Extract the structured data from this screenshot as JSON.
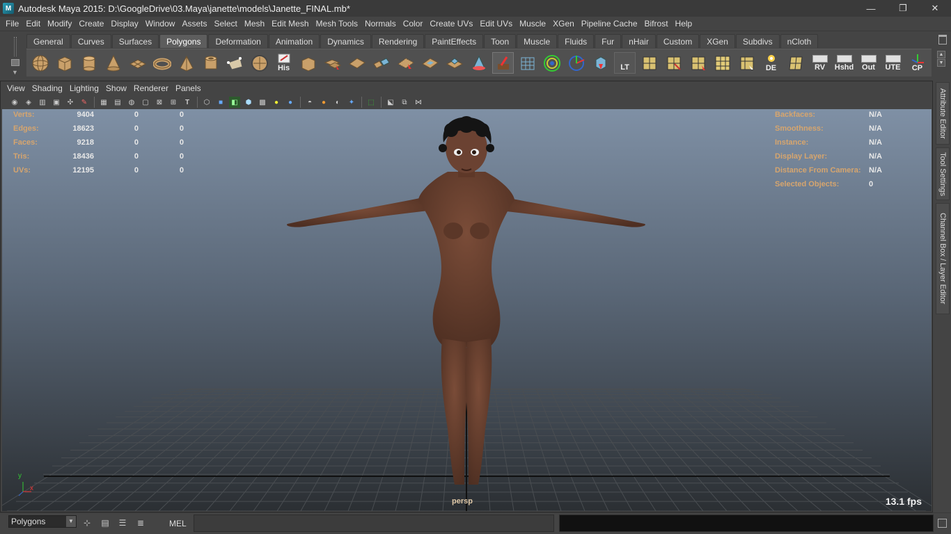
{
  "window": {
    "title": "Autodesk Maya 2015: D:\\GoogleDrive\\03.Maya\\janette\\models\\Janette_FINAL.mb*",
    "minimize_glyph": "—",
    "maximize_glyph": "❐",
    "close_glyph": "✕"
  },
  "menubar": [
    "File",
    "Edit",
    "Modify",
    "Create",
    "Display",
    "Window",
    "Assets",
    "Select",
    "Mesh",
    "Edit Mesh",
    "Mesh Tools",
    "Normals",
    "Color",
    "Create UVs",
    "Edit UVs",
    "Muscle",
    "XGen",
    "Pipeline Cache",
    "Bifrost",
    "Help"
  ],
  "shelf": {
    "tabs": [
      "General",
      "Curves",
      "Surfaces",
      "Polygons",
      "Deformation",
      "Animation",
      "Dynamics",
      "Rendering",
      "PaintEffects",
      "Toon",
      "Muscle",
      "Fluids",
      "Fur",
      "nHair",
      "Custom",
      "XGen",
      "Subdivs",
      "nCloth"
    ],
    "active_tab": "Polygons",
    "text_icons": {
      "his": "His",
      "lt": "LT",
      "de": "DE",
      "rv": "RV",
      "hshd": "Hshd",
      "out": "Out",
      "ute": "UTE",
      "cp": "CP"
    }
  },
  "panel": {
    "menus": [
      "View",
      "Shading",
      "Lighting",
      "Show",
      "Renderer",
      "Panels"
    ]
  },
  "hud": {
    "left": [
      {
        "label": "Verts:",
        "v1": "9404",
        "v2": "0",
        "v3": "0"
      },
      {
        "label": "Edges:",
        "v1": "18623",
        "v2": "0",
        "v3": "0"
      },
      {
        "label": "Faces:",
        "v1": "9218",
        "v2": "0",
        "v3": "0"
      },
      {
        "label": "Tris:",
        "v1": "18436",
        "v2": "0",
        "v3": "0"
      },
      {
        "label": "UVs:",
        "v1": "12195",
        "v2": "0",
        "v3": "0"
      }
    ],
    "right": [
      {
        "label": "Backfaces:",
        "value": "N/A"
      },
      {
        "label": "Smoothness:",
        "value": "N/A"
      },
      {
        "label": "Instance:",
        "value": "N/A"
      },
      {
        "label": "Display Layer:",
        "value": "N/A"
      },
      {
        "label": "Distance From Camera:",
        "value": "N/A"
      },
      {
        "label": "Selected Objects:",
        "value": "0"
      }
    ],
    "camera": "persp",
    "fps": "13.1 fps",
    "axis_x": "x",
    "axis_y": "y"
  },
  "side_tabs": [
    "Attribute Editor",
    "Tool Settings",
    "Channel Box / Layer Editor"
  ],
  "cmdline": {
    "mode": "Polygons",
    "mel_label": "MEL",
    "mel_value": ""
  },
  "colors": {
    "ui_bg": "#444444",
    "hud_label": "#d6a56e",
    "viewport_top": "#7f90a5",
    "viewport_bottom": "#2b2f33",
    "skin": "#6b4232"
  }
}
